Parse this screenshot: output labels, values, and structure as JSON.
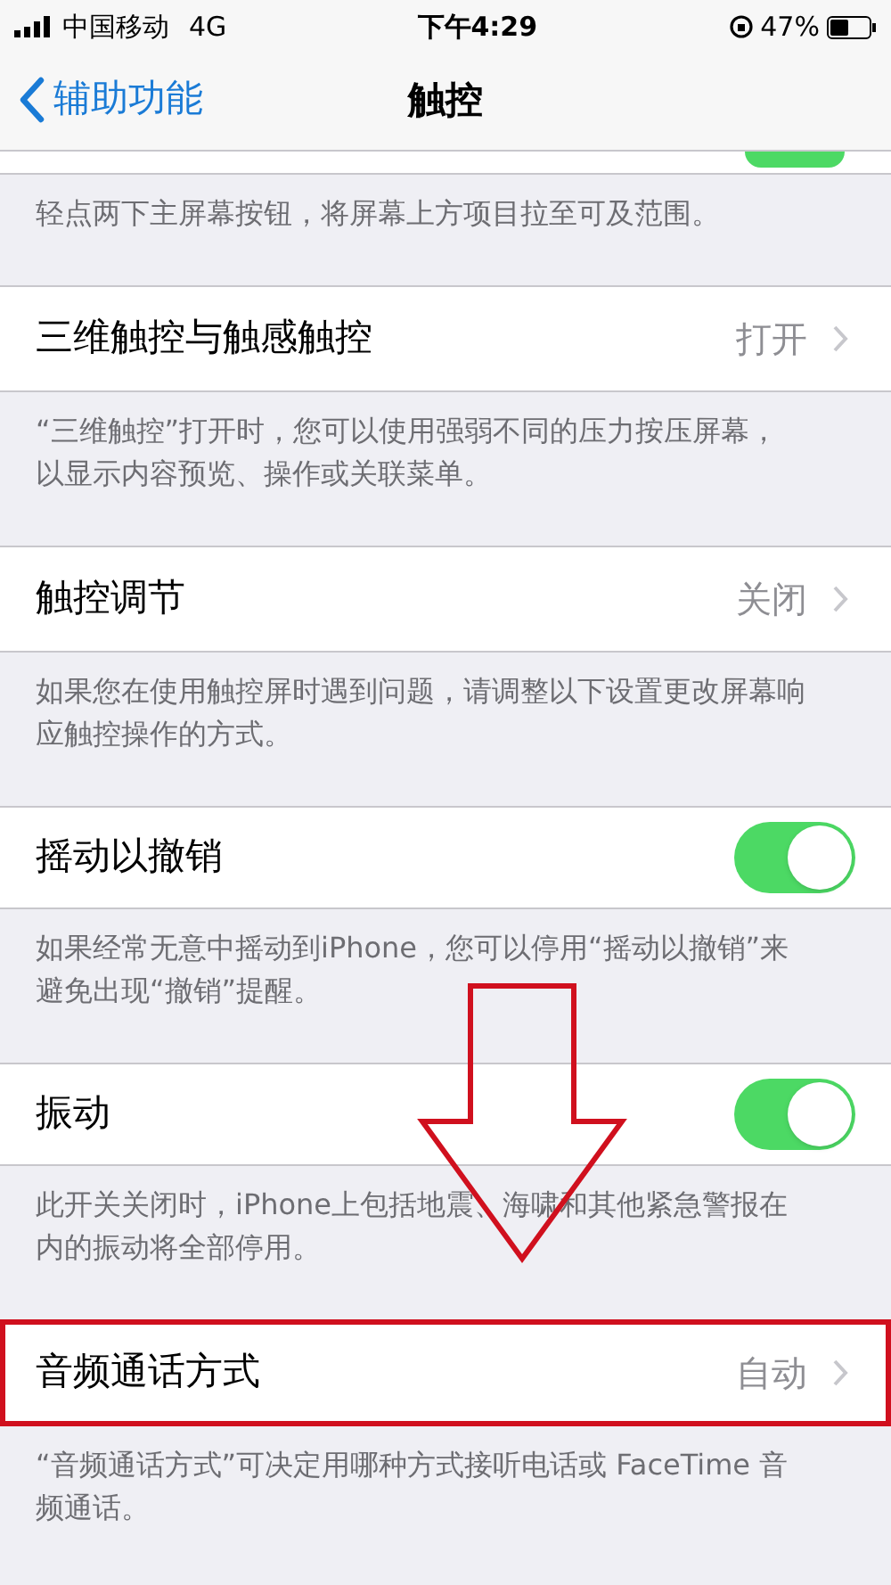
{
  "status_bar": {
    "carrier": "中国移动",
    "network": "4G",
    "time": "下午4:29",
    "battery": "47%"
  },
  "nav": {
    "back": "辅助功能",
    "title": "触控"
  },
  "top_partial": {
    "on": true
  },
  "sections": [
    {
      "kind": "footer",
      "text": "轻点两下主屏幕按钮，将屏幕上方项目拉至可及范围。"
    },
    {
      "kind": "link",
      "label": "三维触控与触感触控",
      "value": "打开",
      "highlighted": false
    },
    {
      "kind": "footer",
      "text": "“三维触控”打开时，您可以使用强弱不同的压力按压屏幕，以显示内容预览、操作或关联菜单。"
    },
    {
      "kind": "link",
      "label": "触控调节",
      "value": "关闭",
      "highlighted": false
    },
    {
      "kind": "footer",
      "text": "如果您在使用触控屏时遇到问题，请调整以下设置更改屏幕响应触控操作的方式。"
    },
    {
      "kind": "toggle",
      "label": "摇动以撤销",
      "on": true
    },
    {
      "kind": "footer",
      "text": "如果经常无意中摇动到iPhone，您可以停用“摇动以撤销”来避免出现“撤销”提醒。"
    },
    {
      "kind": "toggle",
      "label": "振动",
      "on": true
    },
    {
      "kind": "footer",
      "text": "此开关关闭时，iPhone上包括地震、海啸和其他紧急警报在内的振动将全部停用。"
    },
    {
      "kind": "link",
      "label": "音频通话方式",
      "value": "自动",
      "highlighted": true
    },
    {
      "kind": "footer",
      "text": "“音频通话方式”可决定用哪种方式接听电话或 FaceTime 音频通话。"
    }
  ],
  "annotation_arrow": true
}
